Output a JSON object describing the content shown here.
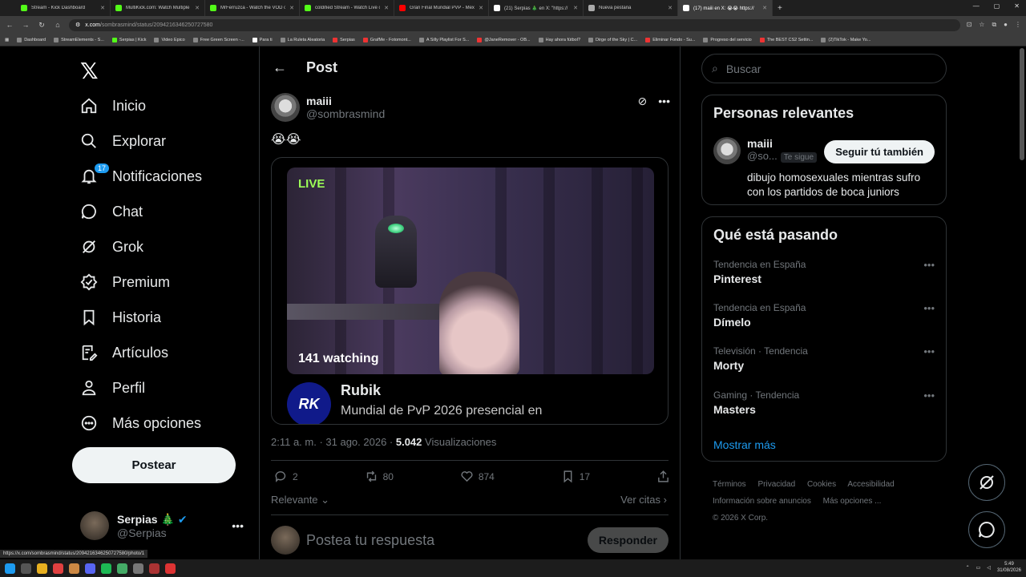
{
  "browser": {
    "tabs": [
      {
        "label": "Stream - Kick Dashboard",
        "color": "#53fc18"
      },
      {
        "label": "MultiKick.com: Watch Multiple",
        "color": "#53fc18"
      },
      {
        "label": "MrFerruzca - Watch the VOD o",
        "color": "#53fc18"
      },
      {
        "label": "coldified Stream - Watch Live o",
        "color": "#53fc18"
      },
      {
        "label": "Gran Final Mundial PVP - Mexic",
        "color": "#ff0000"
      },
      {
        "label": "(21) Serpias 🎄 en X: \"https://",
        "color": "#ffffff"
      },
      {
        "label": "Nueva pestaña",
        "color": "#aaaaaa"
      },
      {
        "label": "(17) maiii en X: 😭😭 https://",
        "color": "#ffffff"
      }
    ],
    "url_domain": "x.com",
    "url_path": "/sombrasmind/status/2094216346250727580",
    "bookmarks": [
      "Dashboard",
      "StreamElements - S...",
      "Serpias | Kick",
      "Video Epico",
      "Free Green Screen -...",
      "Para ti",
      "La Ruleta Aleatoria",
      "Serpias",
      "GrafMe - Fotomont...",
      "A Silly Playlist For S...",
      "@JaneRemover - OB...",
      "Hay ahora fútbol?",
      "Dirge of the Sky | C...",
      "Eliminar Fondo - Su...",
      "Progreso del servicio",
      "The BEST CS2 Settin...",
      "(2)TikTok - Make Yo..."
    ],
    "status_url": "https://x.com/sombrasmind/status/2094216346250727580/photo/1"
  },
  "nav": {
    "items": [
      {
        "label": "Inicio",
        "icon": "home-icon"
      },
      {
        "label": "Explorar",
        "icon": "search-icon"
      },
      {
        "label": "Notificaciones",
        "icon": "bell-icon"
      },
      {
        "label": "Chat",
        "icon": "chat-icon"
      },
      {
        "label": "Grok",
        "icon": "grok-icon"
      },
      {
        "label": "Premium",
        "icon": "premium-icon"
      },
      {
        "label": "Historia",
        "icon": "bookmark-icon"
      },
      {
        "label": "Artículos",
        "icon": "articles-icon"
      },
      {
        "label": "Perfil",
        "icon": "profile-icon"
      },
      {
        "label": "Más opciones",
        "icon": "more-icon"
      }
    ],
    "notif_count": "17",
    "post_button": "Postear",
    "account": {
      "name": "Serpias 🎄",
      "handle": "@Serpias"
    }
  },
  "header": {
    "title": "Post"
  },
  "post": {
    "author_name": "maiii",
    "author_handle": "@sombrasmind",
    "text": "😭😭",
    "live_badge": "LIVE",
    "watching": "141 watching",
    "channel_name": "Rubik",
    "channel_logo": "RK",
    "stream_title": "Mundial de PvP 2026 presencial en",
    "timestamp": "2:11 a. m. · 31 ago. 2026 · ",
    "views": "5.042",
    "views_label": " Visualizaciones",
    "replies": "2",
    "reposts": "80",
    "likes": "874",
    "bookmarks": "17",
    "sort": "Relevante",
    "quotes": "Ver citas",
    "reply_placeholder": "Postea tu respuesta",
    "reply_button": "Responder"
  },
  "sidebar": {
    "search_placeholder": "Buscar",
    "relevant_title": "Personas relevantes",
    "person": {
      "name": "maiii",
      "handle": "@so...",
      "follows_you": "Te sigue",
      "follow_button": "Seguir tú también",
      "bio": "dibujo homosexuales mientras sufro con los partidos de boca juniors"
    },
    "trends_title": "Qué está pasando",
    "trends": [
      {
        "category": "Tendencia en España",
        "name": "Pinterest"
      },
      {
        "category": "Tendencia en España",
        "name": "Dímelo"
      },
      {
        "category": "Televisión · Tendencia",
        "name": "Morty"
      },
      {
        "category": "Gaming · Tendencia",
        "name": "Masters"
      }
    ],
    "show_more": "Mostrar más",
    "footer": [
      "Términos",
      "Privacidad",
      "Cookies",
      "Accesibilidad",
      "Información sobre anuncios",
      "Más opciones ...",
      "© 2026 X Corp."
    ]
  },
  "taskbar": {
    "time": "5:49",
    "date": "31/08/2026"
  }
}
